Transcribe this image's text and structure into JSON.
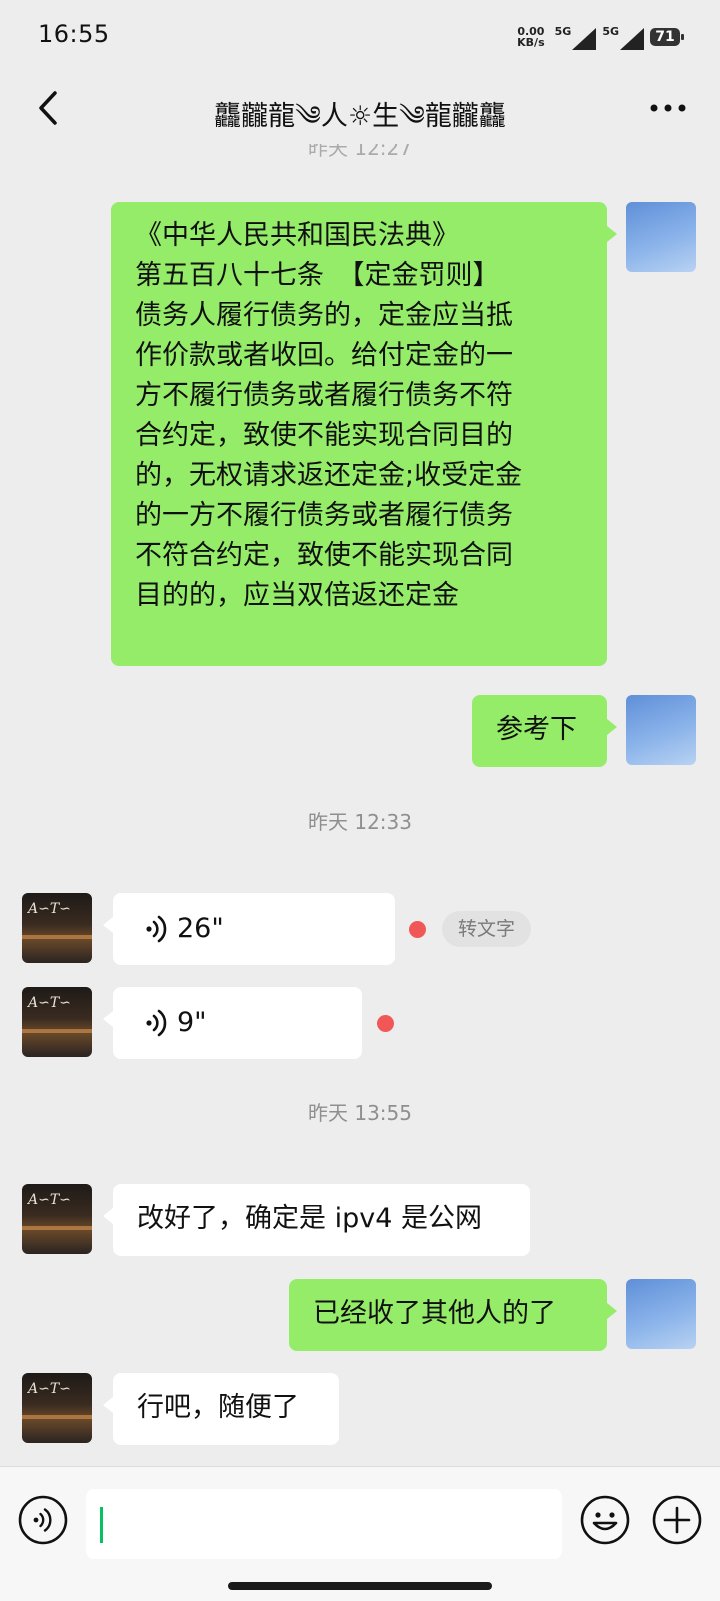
{
  "status_bar": {
    "time": "16:55",
    "net_speed_top": "0.00",
    "net_speed_bottom": "KB/s",
    "signal1_label": "5G",
    "signal2_label": "5G",
    "battery": "71"
  },
  "header": {
    "title": "龘龖龍༄人☼生༄龍龖龘"
  },
  "messages": {
    "partial_timestamp": "昨天 12:27",
    "law_lines": [
      "《中华人民共和国民法典》",
      "第五百八十七条　【定金罚则】",
      "债务人履行债务的，定金应当抵",
      "作价款或者收回。给付定金的一",
      "方不履行债务或者履行债务不符",
      "合约定，致使不能实现合同目的",
      "的，无权请求返还定金;收受定金",
      "的一方不履行债务或者履行债务",
      "不符合约定，致使不能实现合同",
      "目的的，应当双倍返还定金"
    ],
    "reference": "参考下",
    "ts2": "昨天 12:33",
    "voice1": "26\"",
    "to_text": "转文字",
    "voice2": "9\"",
    "ts3": "昨天 13:55",
    "msg_changed": "改好了，确定是 ipv4 是公网",
    "msg_taken": "已经收了其他人的了",
    "msg_whatever": "行吧，随便了"
  },
  "colors": {
    "bubble_self": "#95ec69",
    "bubble_other": "#ffffff",
    "background": "#ededed",
    "unread_dot": "#f25757",
    "caret": "#07c160"
  },
  "icons": [
    "back-arrow-icon",
    "more-icon",
    "voice-wave-icon",
    "voice-input-icon",
    "emoji-icon",
    "plus-icon"
  ]
}
